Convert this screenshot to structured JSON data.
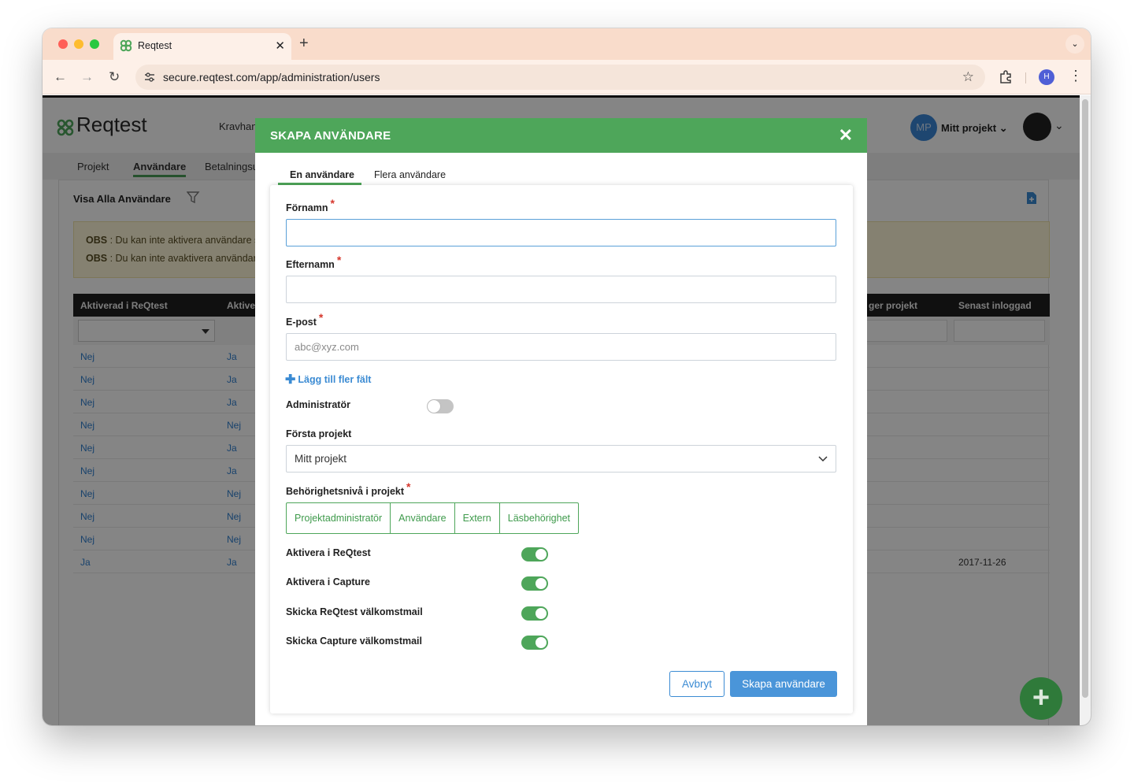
{
  "browser": {
    "tab_title": "Reqtest",
    "url": "secure.reqtest.com/app/administration/users",
    "profile_initial": "H"
  },
  "app": {
    "logo_text": "Reqtest",
    "nav_item": "Kravhan",
    "project_initials": "MP",
    "project_name": "Mitt projekt",
    "subnav": [
      "Projekt",
      "Användare",
      "Betalningsu"
    ],
    "panel_title": "Visa Alla Användare",
    "notice": [
      {
        "label": "OBS",
        "text": " : Du kan inte aktivera användare s"
      },
      {
        "label": "OBS",
        "text": " : Du kan inte avaktivera användare"
      }
    ],
    "columns": {
      "c1": "Aktiverad i ReQtest",
      "c2": "Aktive",
      "c3": "ger projekt",
      "c4": "Senast inloggad"
    },
    "rows": [
      {
        "a": "Nej",
        "b": "Ja",
        "date": ""
      },
      {
        "a": "Nej",
        "b": "Ja",
        "date": ""
      },
      {
        "a": "Nej",
        "b": "Ja",
        "date": ""
      },
      {
        "a": "Nej",
        "b": "Nej",
        "date": ""
      },
      {
        "a": "Nej",
        "b": "Ja",
        "date": ""
      },
      {
        "a": "Nej",
        "b": "Ja",
        "date": ""
      },
      {
        "a": "Nej",
        "b": "Nej",
        "date": ""
      },
      {
        "a": "Nej",
        "b": "Nej",
        "date": ""
      },
      {
        "a": "Nej",
        "b": "Nej",
        "date": ""
      },
      {
        "a": "Ja",
        "b": "Ja",
        "date": "2017-11-26"
      }
    ],
    "fab_label": "+"
  },
  "modal": {
    "title": "SKAPA ANVÄNDARE",
    "tabs": [
      "En användare",
      "Flera användare"
    ],
    "first_name_label": "Förnamn",
    "first_name_value": "",
    "last_name_label": "Efternamn",
    "last_name_value": "",
    "email_label": "E-post",
    "email_placeholder": "abc@xyz.com",
    "required_mark": "*",
    "add_more": "Lägg till fler fält",
    "admin_label": "Administratör",
    "admin_on": false,
    "first_project_label": "Första projekt",
    "first_project_value": "Mitt projekt",
    "permission_label": "Behörighetsnivå i projekt",
    "permission_options": [
      "Projektadministratör",
      "Användare",
      "Extern",
      "Läsbehörighet"
    ],
    "toggles": [
      {
        "label": "Aktivera i ReQtest",
        "on": true
      },
      {
        "label": "Aktivera i Capture",
        "on": true
      },
      {
        "label": "Skicka ReQtest välkomstmail",
        "on": true
      },
      {
        "label": "Skicka Capture välkomstmail",
        "on": true
      }
    ],
    "cancel_label": "Avbryt",
    "create_label": "Skapa användare"
  },
  "colors": {
    "accent": "#4ea65a",
    "link": "#3b8bd3",
    "primary_button": "#4a95d9",
    "tabbar": "#f9dccb"
  }
}
